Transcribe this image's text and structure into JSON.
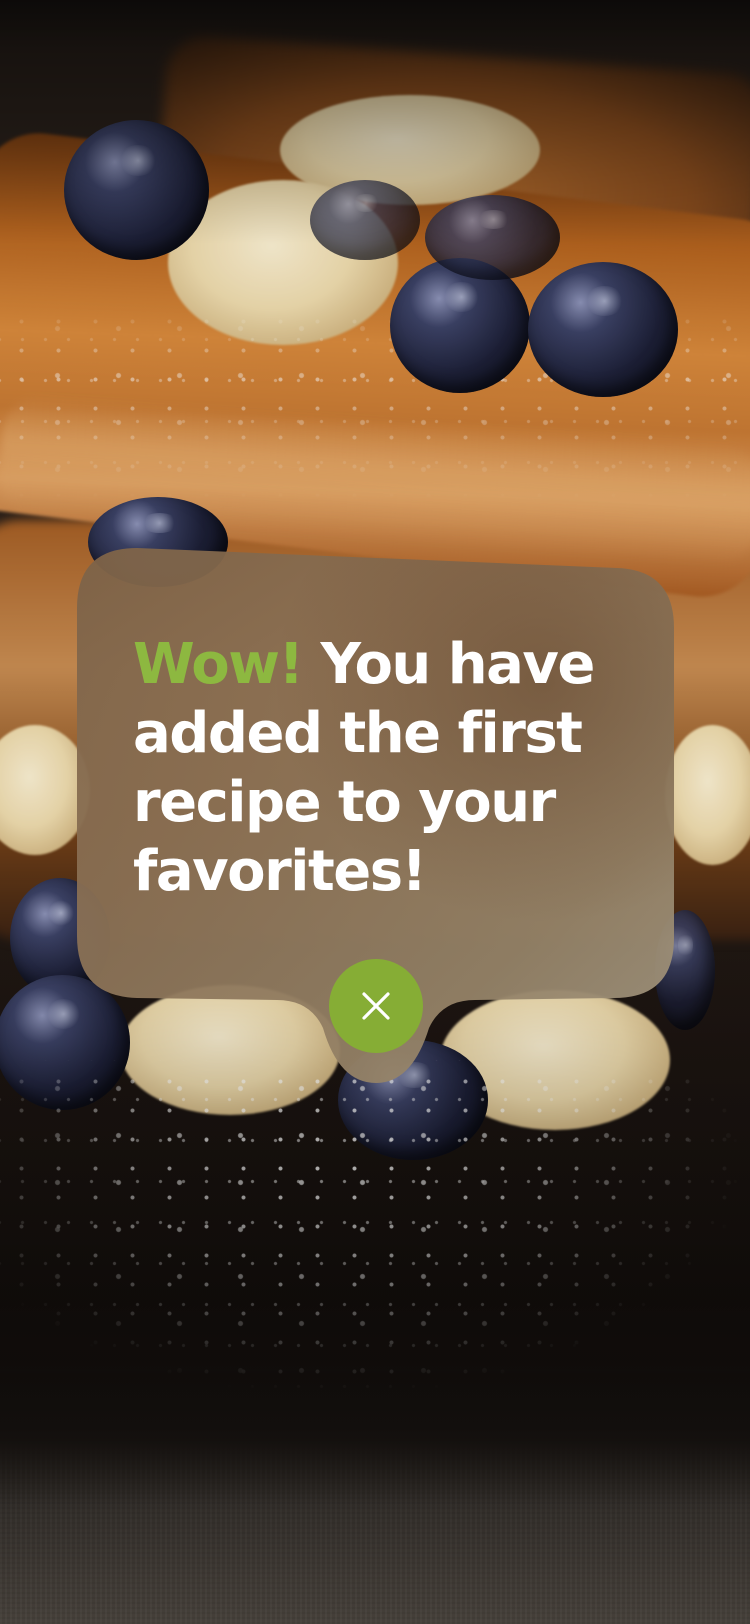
{
  "notification": {
    "highlight": "Wow!",
    "message": " You have added the first recipe to your favorites!",
    "close_icon": "close-icon"
  },
  "background": {
    "subject": "french toast with banana slices and blueberries"
  },
  "colors": {
    "accent": "#8db840",
    "close_button": "#86ad35",
    "message_text": "#ffffff"
  }
}
